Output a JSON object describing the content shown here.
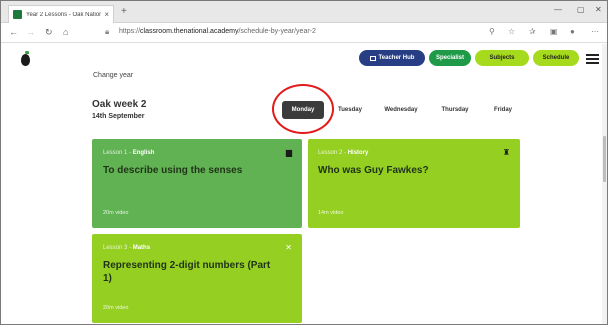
{
  "browser": {
    "tab_title": "Year 2 Lessons - Oak National A...",
    "tab_close": "×",
    "new_tab": "+",
    "url_scheme": "https://",
    "url_host": "classroom.thenational.academy",
    "url_path": "/schedule-by-year/year-2",
    "minimize": "—",
    "close": "✕"
  },
  "header": {
    "buttons": [
      "Teacher Hub",
      "Specialist",
      "Subjects",
      "Schedule"
    ]
  },
  "schedule": {
    "change_year": "Change year",
    "week_title": "Oak week 2",
    "week_date": "14th September",
    "days": [
      "Monday",
      "Tuesday",
      "Wednesday",
      "Thursday",
      "Friday"
    ],
    "selected_day": "Monday"
  },
  "lessons": [
    {
      "number": "Lesson 1",
      "subject": "English",
      "title": "To describe using the senses",
      "duration": "20m video",
      "color": "#61b253",
      "icon": "book-icon"
    },
    {
      "number": "Lesson 2",
      "subject": "History",
      "title": "Who was Guy Fawkes?",
      "duration": "14m video",
      "color": "#95cf22",
      "icon": "castle-icon"
    },
    {
      "number": "Lesson 3",
      "subject": "Maths",
      "title": "Representing 2-digit numbers (Part 1)",
      "duration": "20m video",
      "color": "#95cf22",
      "icon": "calculator-icon"
    }
  ],
  "colors": {
    "teacher_hub": "#273e84",
    "specialist": "#1e9a48",
    "subjects": "#a6da1c",
    "schedule": "#a6da1c",
    "selected_day": "#3b3b3b",
    "annotation_ring": "#e31a1a"
  }
}
